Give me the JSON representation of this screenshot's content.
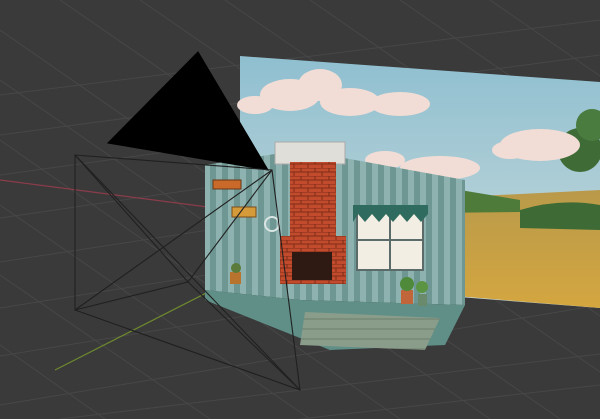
{
  "app": {
    "name": "3D viewport"
  },
  "viewport": {
    "background": "#3a3a3a",
    "grid_color": "#474747",
    "x_axis_color": "#8a3c4a",
    "y_axis_color": "#6e8a2e"
  },
  "scene": {
    "objects": [
      {
        "name": "camera",
        "icon": "camera-frustum-icon"
      },
      {
        "name": "backdrop",
        "icon": "sky-field-backdrop"
      },
      {
        "name": "room-diorama",
        "icon": "room-interior"
      }
    ],
    "colors": {
      "sky": "#a8c8cf",
      "field": "#c89a3e",
      "brick": "#c14a2c",
      "wall_stripe_light": "#8fb3b1",
      "wall_stripe_dark": "#6f9795",
      "floor": "#8aa28a"
    }
  }
}
